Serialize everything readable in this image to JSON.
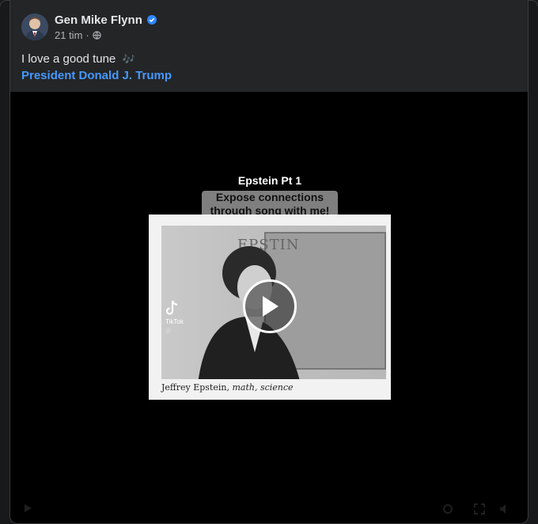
{
  "post": {
    "author": "Gen Mike Flynn",
    "time": "21 tim",
    "separator": "·",
    "text": "I love a good tune",
    "note_emoji": "🎶",
    "mention": "President Donald J. Trump"
  },
  "video": {
    "caption_title": "Epstein Pt 1",
    "caption_sub_line1": "Expose connections",
    "caption_sub_line2": "through song with me!",
    "photo_caption_name": "Jeffrey Epstein,",
    "photo_caption_subjects": "math, science",
    "board_text": "EPSTIN",
    "watermark": "TikTok",
    "watermark_handle": "@"
  },
  "colors": {
    "card_bg": "#242526",
    "page_bg": "#18191a",
    "link": "#4599ff",
    "verified": "#2d88ff"
  },
  "icons": {
    "verified": "verified-badge-icon",
    "privacy": "globe-icon",
    "play": "play-icon",
    "tiktok": "tiktok-logo-icon"
  }
}
